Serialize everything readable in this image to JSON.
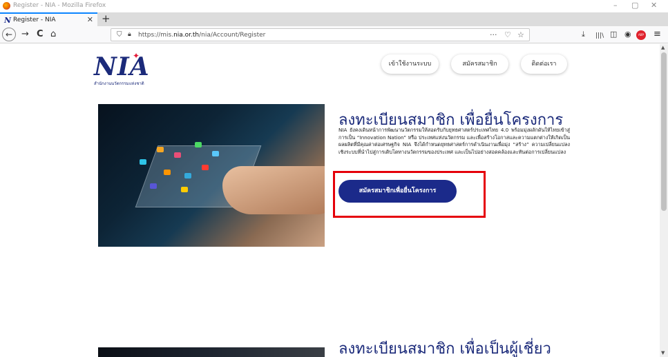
{
  "window": {
    "title": "Register - NIA - Mozilla Firefox",
    "minimize": "–",
    "restore": "▢",
    "close": "✕"
  },
  "tab": {
    "label": "Register - NIA",
    "close": "✕",
    "new_tab": "+"
  },
  "navbar": {
    "back": "←",
    "forward": "→",
    "reload": "C",
    "home": "⌂",
    "url_prefix": "https://mis.",
    "url_domain": "nia.or.th",
    "url_path": "/nia/Account/Register",
    "more": "···",
    "pocket": "♡",
    "bookmark": "☆",
    "download": "⤓",
    "library": "|||\\",
    "sidebar": "◫",
    "account": "◉",
    "adblock": "ABP",
    "menu": "≡"
  },
  "header": {
    "logo_text": "NIA",
    "logo_subtitle": "สำนักงานนวัตกรรมแห่งชาติ",
    "nav": [
      "เข้าใช้งานระบบ",
      "สมัครสมาชิก",
      "ติดต่อเรา"
    ]
  },
  "section1": {
    "title": "ลงทะเบียนสมาชิก เพื่อยื่นโครงการ",
    "body": "NIA ยังคงเดินหน้าการพัฒนานวัตกรรมให้สอดรับกับยุทธศาสตร์ประเทศไทย 4.0 พร้อมมุ่งผลักดันให้ไทยเข้าสู่การเป็น “Innovation Nation” หรือ ประเทศแห่งนวัตกรรม และเพื่อสร้างโอกาสและความแตกต่างให้เกิดเป็นผลผลิตที่มีคุณค่าต่อเศรษฐกิจ NIA จึงได้กำหนดยุทธศาสตร์การดำเนินงานเพื่อมุ่ง “สร้าง” ความเปลี่ยนแปลงเชิงระบบที่นำไปสู่การเติบโตทางนวัตกรรมของประเทศ และเป็นไปอย่างสอดคล้องและทันต่อการเปลี่ยนแปลง",
    "cta": "สมัครสมาชิกเพื่อยื่นโครงการ"
  },
  "section2": {
    "title": "ลงทะเบียนสมาชิก เพื่อเป็นผู้เชี่ยว"
  },
  "colors": {
    "brand": "#1b2a7a",
    "cta": "#1b2a8a",
    "highlight": "#e5000a",
    "accent": "#e51937"
  }
}
